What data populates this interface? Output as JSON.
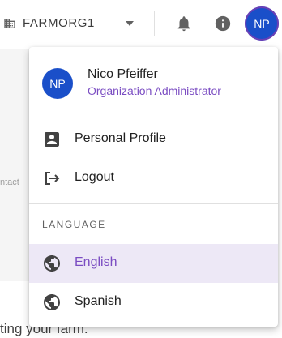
{
  "topbar": {
    "org_name": "FARMORG1",
    "avatar_initials": "NP",
    "icons": [
      "building-icon",
      "caret-down-icon",
      "bell-icon",
      "info-icon"
    ]
  },
  "background": {
    "contact_fragment": "ntact",
    "footer_fragment": "ting your farm."
  },
  "menu": {
    "avatar_initials": "NP",
    "user_name": "Nico Pfeiffer",
    "user_role": "Organization Administrator",
    "items": [
      {
        "label": "Personal Profile",
        "icon": "account-box-icon"
      },
      {
        "label": "Logout",
        "icon": "logout-icon"
      }
    ],
    "language_section": "LANGUAGE",
    "languages": [
      {
        "label": "English",
        "icon": "globe-icon",
        "selected": true
      },
      {
        "label": "Spanish",
        "icon": "globe-icon",
        "selected": false
      }
    ]
  },
  "colors": {
    "avatar_bg": "#1a4fc9",
    "accent_purple": "#7a4cc2",
    "selected_bg": "#ede8f6"
  }
}
